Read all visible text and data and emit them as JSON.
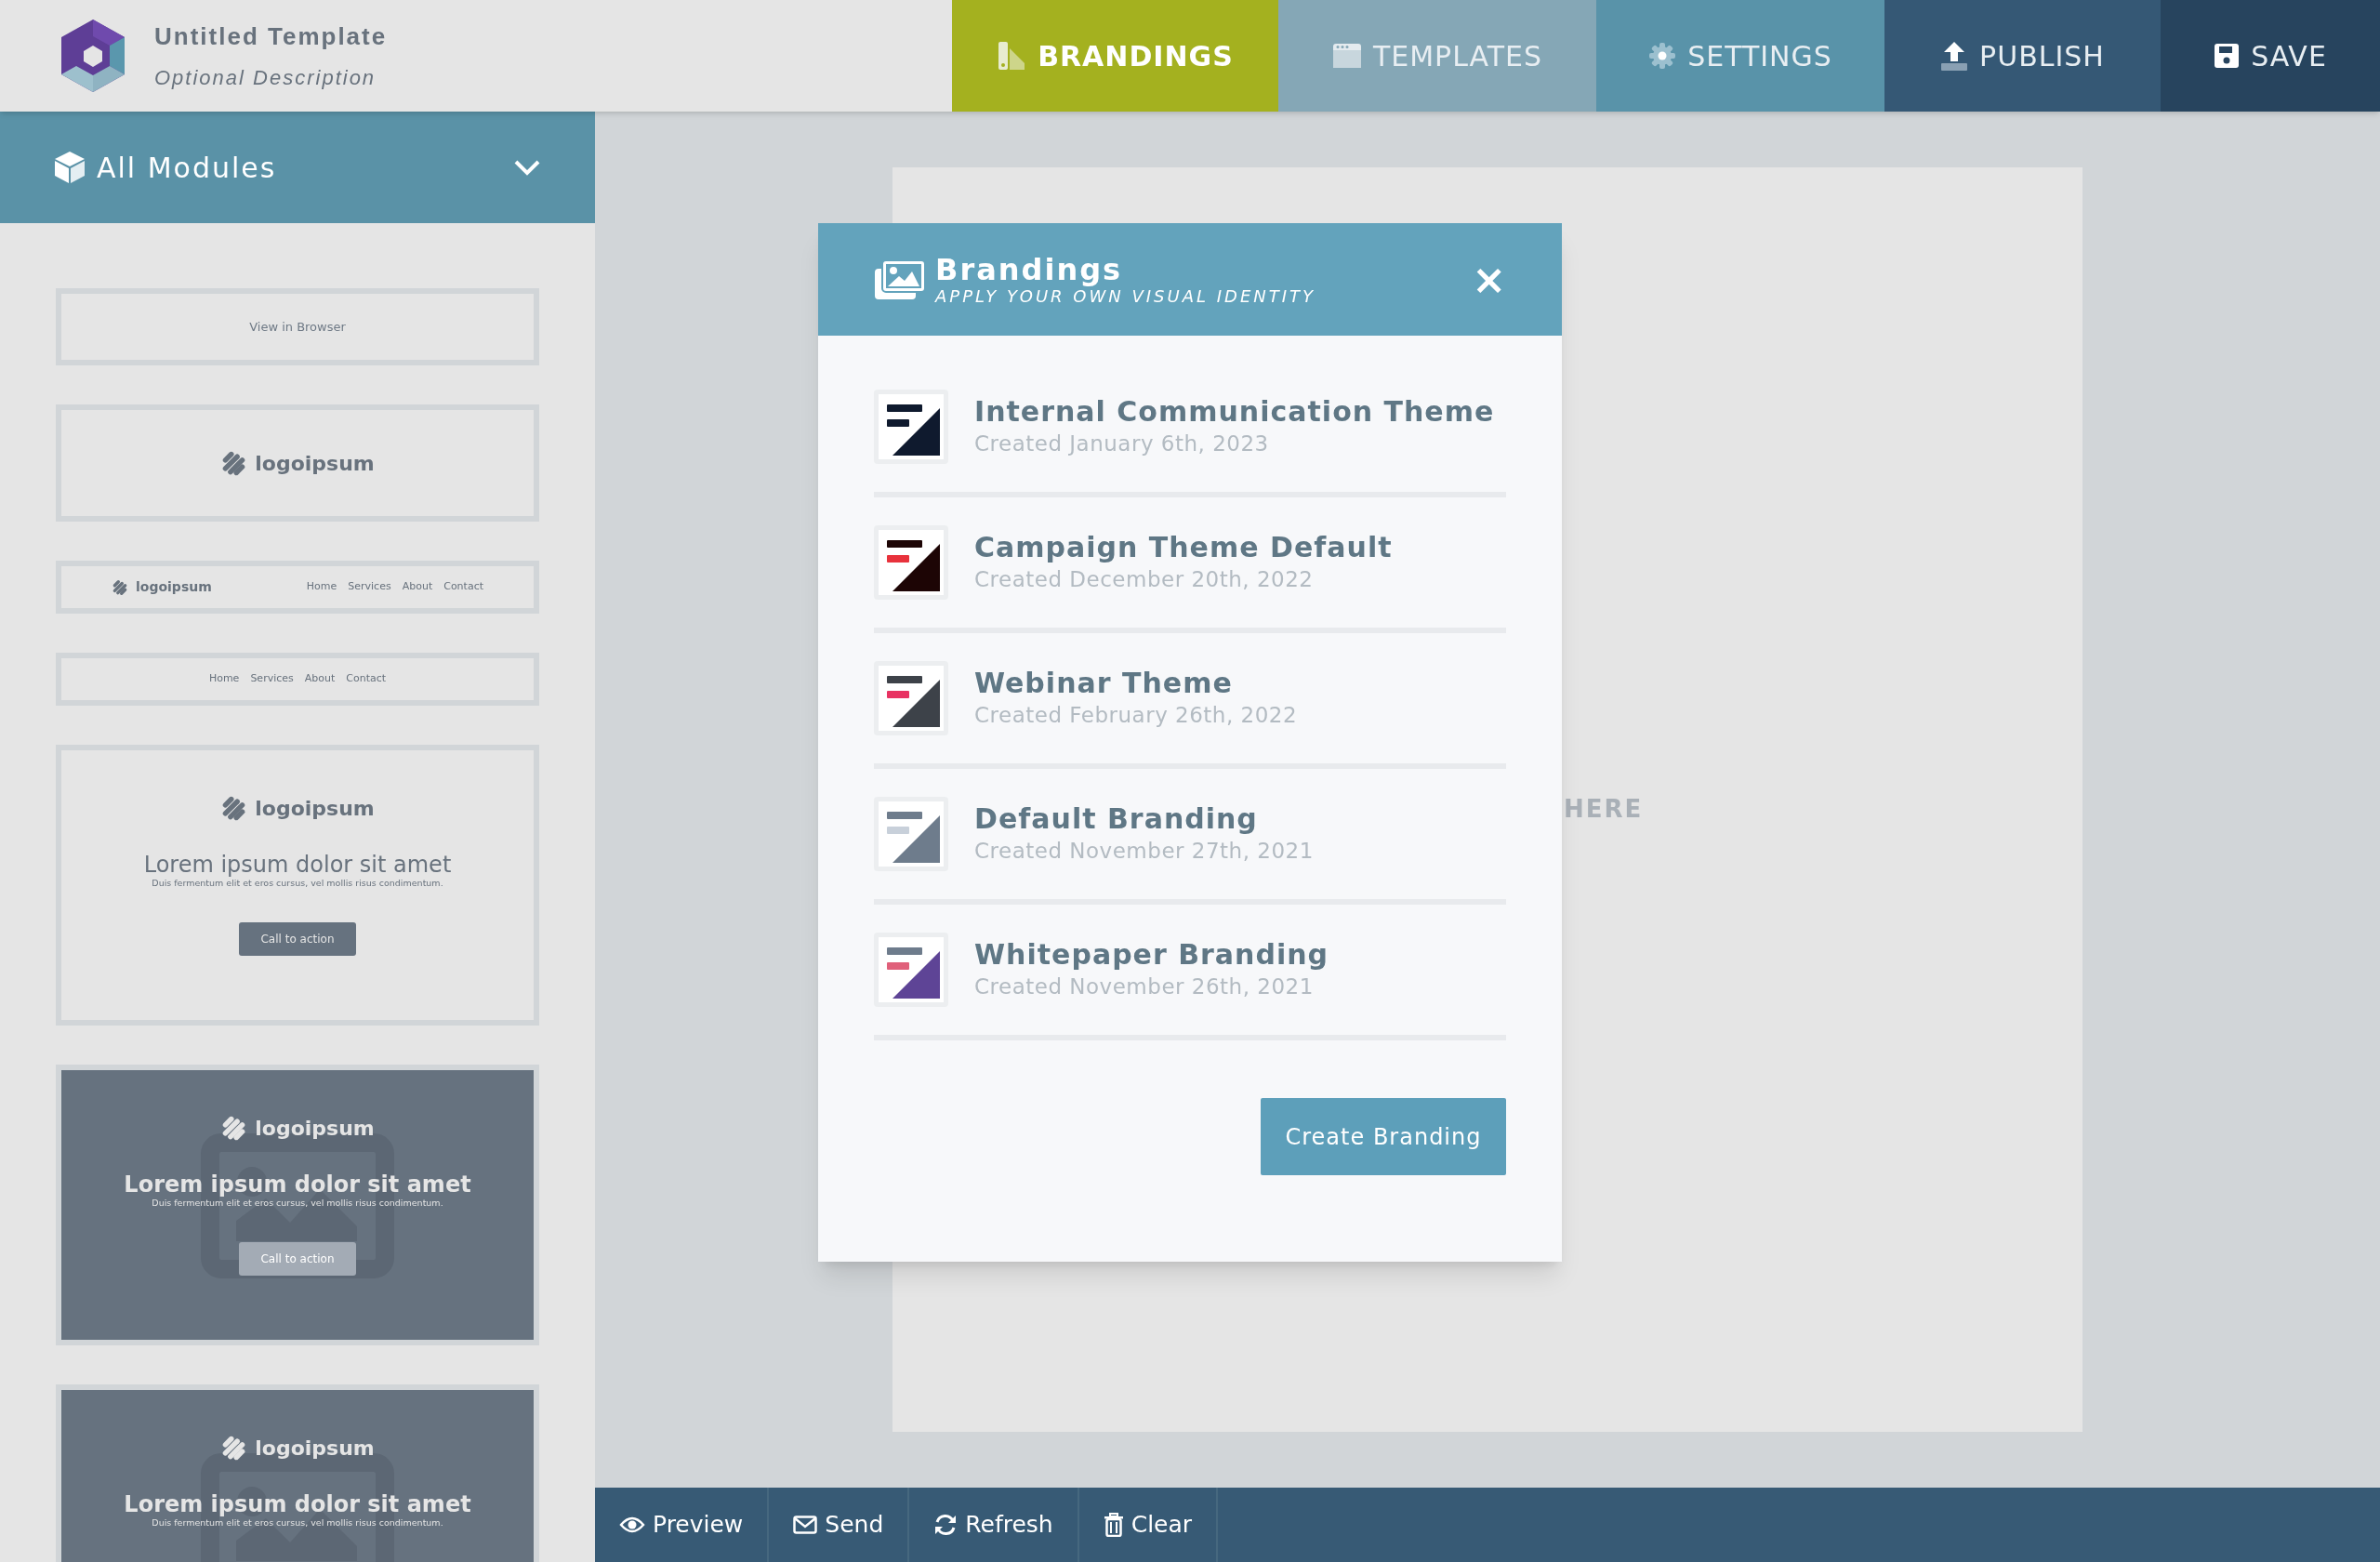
{
  "header": {
    "title": "Untitled Template",
    "description": "Optional Description"
  },
  "tabs": [
    {
      "kind": "brandings",
      "label": "BRANDINGS",
      "color": "#a4b11f",
      "selected": true
    },
    {
      "kind": "templates",
      "label": "TEMPLATES",
      "color": "#85a7b6",
      "selected": false
    },
    {
      "kind": "settings",
      "label": "SETTINGS",
      "color": "#5993a9",
      "selected": false
    },
    {
      "kind": "publish",
      "label": "PUBLISH",
      "color": "#355875",
      "selected": false
    },
    {
      "kind": "save",
      "label": "SAVE",
      "color": "#27445e",
      "selected": false
    }
  ],
  "sidebar": {
    "dropdown": "All Modules",
    "modules": [
      {
        "kind": "text",
        "text": "View in Browser"
      },
      {
        "kind": "logo",
        "logo": "logoipsum"
      },
      {
        "kind": "logo-nav",
        "logo": "logoipsum",
        "links": [
          "Home",
          "Services",
          "About",
          "Contact"
        ]
      },
      {
        "kind": "nav",
        "links": [
          "Home",
          "Services",
          "About",
          "Contact"
        ]
      },
      {
        "kind": "hero-light",
        "logo": "logoipsum",
        "heading": "Lorem ipsum dolor sit amet",
        "text": "Duis fermentum elit et eros cursus, vel mollis risus condimentum.",
        "button": "Call to action"
      },
      {
        "kind": "hero-dark",
        "logo": "logoipsum",
        "heading": "Lorem ipsum dolor sit amet",
        "text": "Duis fermentum elit et eros cursus, vel mollis risus condimentum.",
        "button": "Call to action"
      },
      {
        "kind": "hero-dark",
        "logo": "logoipsum",
        "heading": "Lorem ipsum dolor sit amet",
        "text": "Duis fermentum elit et eros cursus, vel mollis risus condimentum."
      }
    ]
  },
  "canvas": {
    "placeholder": "HERE"
  },
  "modal": {
    "title": "Brandings",
    "subtitle": "APPLY YOUR OWN VISUAL IDENTITY",
    "close": "×",
    "items": [
      {
        "name": "Internal Communication Theme",
        "created": "Created January 6th, 2023",
        "color": "#0f1a2e",
        "bars": [
          {
            "color": "#0f1a2e"
          },
          {
            "color": "#0f1a2e"
          }
        ]
      },
      {
        "name": "Campaign Theme Default",
        "created": "Created December 20th, 2022",
        "color": "#1d0505",
        "bars": [
          {
            "color": "#1d0505"
          },
          {
            "color": "#e8323c"
          }
        ]
      },
      {
        "name": "Webinar Theme",
        "created": "Created February 26th, 2022",
        "color": "#3d4249",
        "bars": [
          {
            "color": "#3d4249"
          },
          {
            "color": "#e83262"
          }
        ]
      },
      {
        "name": "Default Branding",
        "created": "Created November 27th, 2021",
        "color": "#6e7c8c",
        "bars": [
          {
            "color": "#6e7c8c"
          },
          {
            "color": "#c8d0da"
          }
        ]
      },
      {
        "name": "Whitepaper Branding",
        "created": "Created November 26th, 2021",
        "color": "#5e4496",
        "bars": [
          {
            "color": "#6e7c8c"
          },
          {
            "color": "#e0607a"
          }
        ]
      }
    ],
    "button": "Create Branding"
  },
  "toolbar": [
    {
      "kind": "preview",
      "label": "Preview"
    },
    {
      "kind": "send",
      "label": "Send"
    },
    {
      "kind": "refresh",
      "label": "Refresh"
    },
    {
      "kind": "clear",
      "label": "Clear"
    }
  ]
}
